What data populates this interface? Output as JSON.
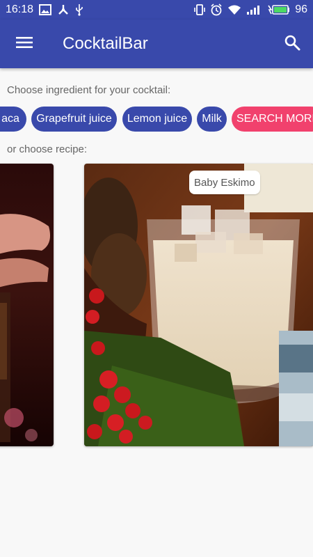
{
  "status_bar": {
    "time": "16:18",
    "battery": "96"
  },
  "app_bar": {
    "title": "CocktailBar"
  },
  "ingredients": {
    "label": "Choose ingredient for your cocktail:",
    "chips": [
      "aca",
      "Grapefruit juice",
      "Lemon juice",
      "Milk"
    ],
    "more_label": "SEARCH MORE"
  },
  "recipes": {
    "label": "or choose recipe:",
    "cards": [
      {
        "title": ""
      },
      {
        "title": "Baby Eskimo"
      }
    ]
  },
  "colors": {
    "primary": "#3949ab",
    "accent": "#f1416d",
    "background": "#f8f8f8"
  },
  "icons": [
    "gallery-icon",
    "tools-icon",
    "usb-icon",
    "vibrate-icon",
    "alarm-icon",
    "wifi-icon",
    "signal-icon",
    "battery-icon",
    "menu-icon",
    "search-icon"
  ]
}
